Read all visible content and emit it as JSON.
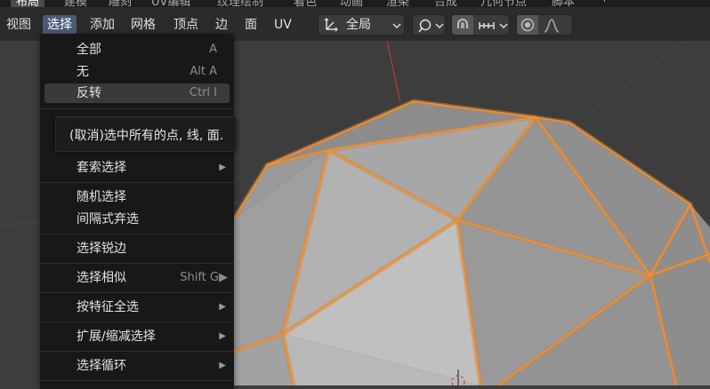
{
  "top_tabs": [
    "布局",
    "建模",
    "雕刻",
    "UV编辑",
    "纹理绘制",
    "着色",
    "动画",
    "渲染",
    "合成",
    "几何节点",
    "脚本",
    "+"
  ],
  "header": {
    "menus": [
      "视图",
      "选择",
      "添加",
      "网格",
      "顶点",
      "边",
      "面",
      "UV"
    ],
    "transform_orientation": "全局"
  },
  "dropdown": {
    "items": [
      {
        "label": "全部",
        "shortcut": "A"
      },
      {
        "label": "无",
        "shortcut": "Alt A"
      },
      {
        "label": "反转",
        "shortcut": "Ctrl I"
      },
      {
        "label": "套索选择",
        "shortcut": "▶"
      },
      {
        "label": "随机选择",
        "shortcut": ""
      },
      {
        "label": "间隔式弃选",
        "shortcut": ""
      },
      {
        "label": "选择锐边",
        "shortcut": ""
      },
      {
        "label": "选择相似",
        "shortcut": "Shift G▶"
      },
      {
        "label": "按特征全选",
        "shortcut": "▶"
      },
      {
        "label": "扩展/缩减选择",
        "shortcut": "▶"
      },
      {
        "label": "选择循环",
        "shortcut": "▶"
      }
    ]
  },
  "tooltip": "(取消)选中所有的点, 线, 面.",
  "colors": {
    "header_bg": "#2b2b2b",
    "menu_active": "#4a5b74",
    "viewport_bg": "#3d3d3d",
    "mesh_face": "#a4a4a4",
    "edge_selected": "#f0922b"
  }
}
